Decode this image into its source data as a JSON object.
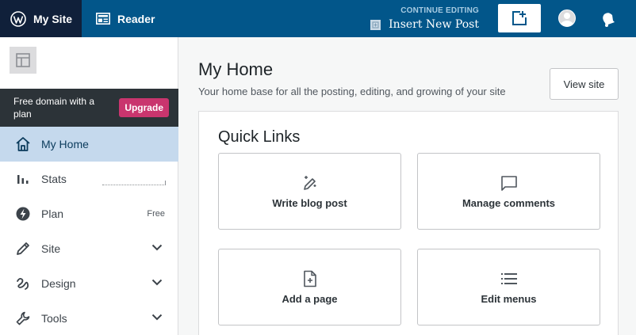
{
  "topbar": {
    "my_site_label": "My Site",
    "reader_label": "Reader",
    "continue_label": "CONTINUE EDITING",
    "continue_title": "Insert New Post"
  },
  "sidebar": {
    "promo_text": "Free domain with a plan",
    "promo_button": "Upgrade",
    "items": [
      {
        "label": "My Home"
      },
      {
        "label": "Stats"
      },
      {
        "label": "Plan",
        "badge": "Free"
      },
      {
        "label": "Site"
      },
      {
        "label": "Design"
      },
      {
        "label": "Tools"
      }
    ]
  },
  "main": {
    "title": "My Home",
    "subtitle": "Your home base for all the posting, editing, and growing of your site",
    "view_site_label": "View site",
    "quick_links": {
      "title": "Quick Links",
      "items": [
        {
          "label": "Write blog post",
          "icon": "pen-icon"
        },
        {
          "label": "Manage comments",
          "icon": "comment-icon"
        },
        {
          "label": "Add a page",
          "icon": "page-add-icon"
        },
        {
          "label": "Edit menus",
          "icon": "menu-icon"
        }
      ]
    }
  },
  "colors": {
    "topbar": "#02568a",
    "my_site_bg": "#10203a",
    "active_item": "#c5d9ed",
    "upgrade": "#c9356e",
    "promo_bg": "#2c3338"
  }
}
